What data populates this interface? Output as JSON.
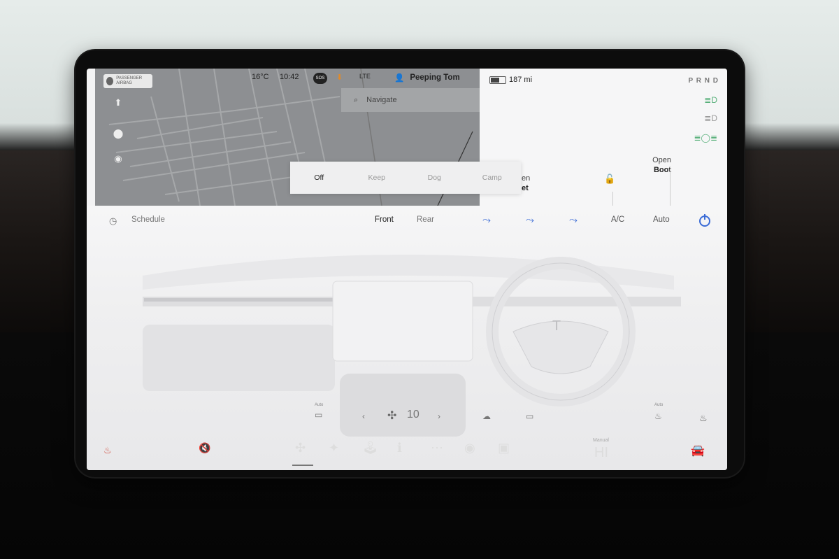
{
  "status_bar": {
    "temperature": "16°C",
    "time": "10:42",
    "sos": "SOS",
    "signal": "LTE",
    "profile_name": "Peeping Tom",
    "airbag_label": "PASSENGER AIRBAG",
    "battery_range": "187 mi",
    "gear_indicator": "P R N D"
  },
  "map": {
    "navigate_placeholder": "Navigate"
  },
  "car_controls": {
    "open_boot_line1": "Open",
    "open_boot_line2": "Boot",
    "open_frunk_line1": "en",
    "open_frunk_line2": "et"
  },
  "keep_climate": {
    "options": [
      "Off",
      "Keep",
      "Dog",
      "Camp"
    ],
    "selected": "Off"
  },
  "climate": {
    "schedule_label": "Schedule",
    "front_label": "Front",
    "rear_label": "Rear",
    "ac_label": "A/C",
    "auto_label": "Auto",
    "accent_color": "#3a6bd6",
    "fan_speed": "10",
    "bottom_auto_left": "Auto",
    "bottom_auto_right": "Auto"
  },
  "dock": {
    "manual_label": "Manual",
    "hi_label": "HI"
  }
}
